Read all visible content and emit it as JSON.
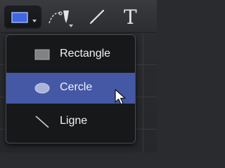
{
  "toolbar": {
    "tools": [
      {
        "name": "rectangle-tool",
        "icon": "rectangle-icon",
        "selected": true
      },
      {
        "name": "pen-tool",
        "icon": "pen-icon",
        "selected": false
      },
      {
        "name": "brush-tool",
        "icon": "brush-icon",
        "selected": false
      },
      {
        "name": "text-tool",
        "icon": "text-icon",
        "glyph": "T",
        "selected": false
      }
    ]
  },
  "menu": {
    "items": [
      {
        "label": "Rectangle",
        "icon": "rectangle-icon",
        "highlighted": false
      },
      {
        "label": "Cercle",
        "icon": "circle-icon",
        "highlighted": true
      },
      {
        "label": "Ligne",
        "icon": "line-icon",
        "highlighted": false
      }
    ]
  },
  "colors": {
    "accent": "#4458a6",
    "selected_tool_fill": "#3f67e0",
    "menu_background": "#17181a"
  }
}
